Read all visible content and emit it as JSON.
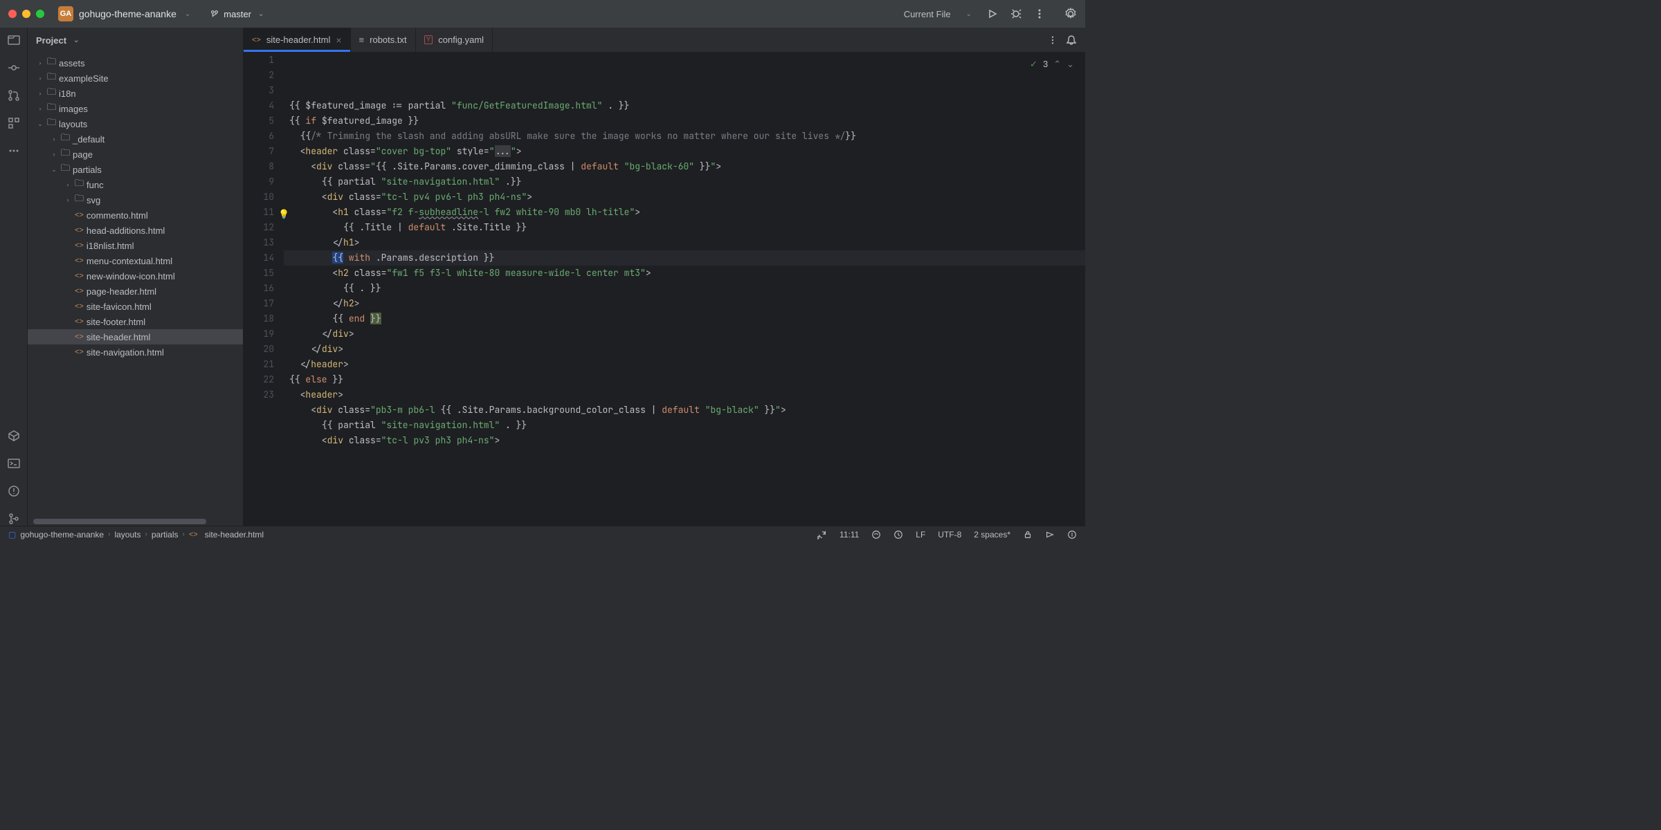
{
  "titlebar": {
    "project_badge": "GA",
    "project_name": "gohugo-theme-ananke",
    "branch": "master",
    "current_file_label": "Current File"
  },
  "sidebar": {
    "header": "Project",
    "tree": [
      {
        "depth": 0,
        "arrow": "›",
        "icon": "folder",
        "label": "assets"
      },
      {
        "depth": 0,
        "arrow": "›",
        "icon": "folder",
        "label": "exampleSite"
      },
      {
        "depth": 0,
        "arrow": "›",
        "icon": "folder",
        "label": "i18n"
      },
      {
        "depth": 0,
        "arrow": "›",
        "icon": "folder",
        "label": "images"
      },
      {
        "depth": 0,
        "arrow": "⌄",
        "icon": "folder",
        "label": "layouts"
      },
      {
        "depth": 1,
        "arrow": "›",
        "icon": "folder",
        "label": "_default"
      },
      {
        "depth": 1,
        "arrow": "›",
        "icon": "folder",
        "label": "page"
      },
      {
        "depth": 1,
        "arrow": "⌄",
        "icon": "folder",
        "label": "partials"
      },
      {
        "depth": 2,
        "arrow": "›",
        "icon": "folder",
        "label": "func"
      },
      {
        "depth": 2,
        "arrow": "›",
        "icon": "folder",
        "label": "svg"
      },
      {
        "depth": 2,
        "arrow": "",
        "icon": "html",
        "label": "commento.html"
      },
      {
        "depth": 2,
        "arrow": "",
        "icon": "html",
        "label": "head-additions.html"
      },
      {
        "depth": 2,
        "arrow": "",
        "icon": "html",
        "label": "i18nlist.html"
      },
      {
        "depth": 2,
        "arrow": "",
        "icon": "html",
        "label": "menu-contextual.html"
      },
      {
        "depth": 2,
        "arrow": "",
        "icon": "html",
        "label": "new-window-icon.html"
      },
      {
        "depth": 2,
        "arrow": "",
        "icon": "html",
        "label": "page-header.html"
      },
      {
        "depth": 2,
        "arrow": "",
        "icon": "html",
        "label": "site-favicon.html"
      },
      {
        "depth": 2,
        "arrow": "",
        "icon": "html",
        "label": "site-footer.html"
      },
      {
        "depth": 2,
        "arrow": "",
        "icon": "html",
        "label": "site-header.html",
        "highlighted": true
      },
      {
        "depth": 2,
        "arrow": "",
        "icon": "html",
        "label": "site-navigation.html"
      }
    ]
  },
  "tabs": [
    {
      "icon": "html",
      "label": "site-header.html",
      "active": true,
      "closable": true
    },
    {
      "icon": "txt",
      "label": "robots.txt"
    },
    {
      "icon": "yaml",
      "label": "config.yaml"
    }
  ],
  "annotation_count": "3",
  "code_lines": [
    {
      "n": 1,
      "html": "{{ $featured_image := partial <span class='str'>\"func/GetFeaturedImage.html\"</span> . }}"
    },
    {
      "n": 2,
      "html": "{{ <span class='kw'>if</span> $featured_image }}"
    },
    {
      "n": 3,
      "html": "  {{<span class='cmt'>/* Trimming the slash and adding absURL make sure the image works no matter where our site lives */</span>}}"
    },
    {
      "n": 4,
      "html": "  &lt;<span class='tag'>header</span> <span class='attr'>class</span>=<span class='str'>\"cover bg-top\"</span> <span class='attr'>style</span>=<span class='str'>\"</span><span style='background:#3a3c40'>...</span><span class='str'>\"</span>&gt;"
    },
    {
      "n": 5,
      "html": "    &lt;<span class='tag'>div</span> <span class='attr'>class</span>=<span class='str'>\"</span>{{ .Site.Params.cover_dimming_class | <span class='kw'>default</span> <span class='str'>\"bg-black-60\"</span> }}<span class='str'>\"</span>&gt;"
    },
    {
      "n": 6,
      "html": "      {{ partial <span class='str'>\"site-navigation.html\"</span> .}}"
    },
    {
      "n": 7,
      "html": "      &lt;<span class='tag'>div</span> <span class='attr'>class</span>=<span class='str'>\"tc-l pv4 pv6-l ph3 ph4-ns\"</span>&gt;"
    },
    {
      "n": 8,
      "html": "        &lt;<span class='tag'>h1</span> <span class='attr'>class</span>=<span class='str'>\"f2 f-<span style='text-decoration:underline wavy #7a7e85'>subheadline</span>-l fw2 white-90 mb0 lh-title\"</span>&gt;"
    },
    {
      "n": 9,
      "html": "          {{ .Title | <span class='kw'>default</span> .Site.Title }}"
    },
    {
      "n": 10,
      "html": "        &lt;/<span class='tag'>h1</span>&gt;"
    },
    {
      "n": 11,
      "html": "        <span class='cursor-mark'>{{</span> <span class='kw'>with</span> .Params.description }}",
      "hl": true,
      "bulb": true
    },
    {
      "n": 12,
      "html": "        &lt;<span class='tag'>h2</span> <span class='attr'>class</span>=<span class='str'>\"fw1 f5 f3-l white-80 measure-wide-l center mt3\"</span>&gt;"
    },
    {
      "n": 13,
      "html": "          {{ . }}"
    },
    {
      "n": 14,
      "html": "        &lt;/<span class='tag'>h2</span>&gt;"
    },
    {
      "n": 15,
      "html": "        {{ <span class='kw'>end</span> <span style='background:#4d5c3a'>}}</span>"
    },
    {
      "n": 16,
      "html": "      &lt;/<span class='tag'>div</span>&gt;"
    },
    {
      "n": 17,
      "html": "    &lt;/<span class='tag'>div</span>&gt;"
    },
    {
      "n": 18,
      "html": "  &lt;/<span class='tag'>header</span>&gt;"
    },
    {
      "n": 19,
      "html": "{{ <span class='kw'>else</span> }}"
    },
    {
      "n": 20,
      "html": "  &lt;<span class='tag'>header</span>&gt;"
    },
    {
      "n": 21,
      "html": "    &lt;<span class='tag'>div</span> <span class='attr'>class</span>=<span class='str'>\"pb3-m pb6-l </span>{{ .Site.Params.background_color_class | <span class='kw'>default</span> <span class='str'>\"bg-black\"</span> }}<span class='str'>\"</span>&gt;"
    },
    {
      "n": 22,
      "html": "      {{ partial <span class='str'>\"site-navigation.html\"</span> . }}"
    },
    {
      "n": 23,
      "html": "      &lt;<span class='tag'>div</span> <span class='attr'>class</span>=<span class='str'>\"tc-l pv3 ph3 ph4-ns\"</span>&gt;"
    }
  ],
  "breadcrumb": [
    "gohugo-theme-ananke",
    "layouts",
    "partials",
    "site-header.html"
  ],
  "status": {
    "pos": "11:11",
    "line_sep": "LF",
    "encoding": "UTF-8",
    "indent": "2 spaces*"
  }
}
